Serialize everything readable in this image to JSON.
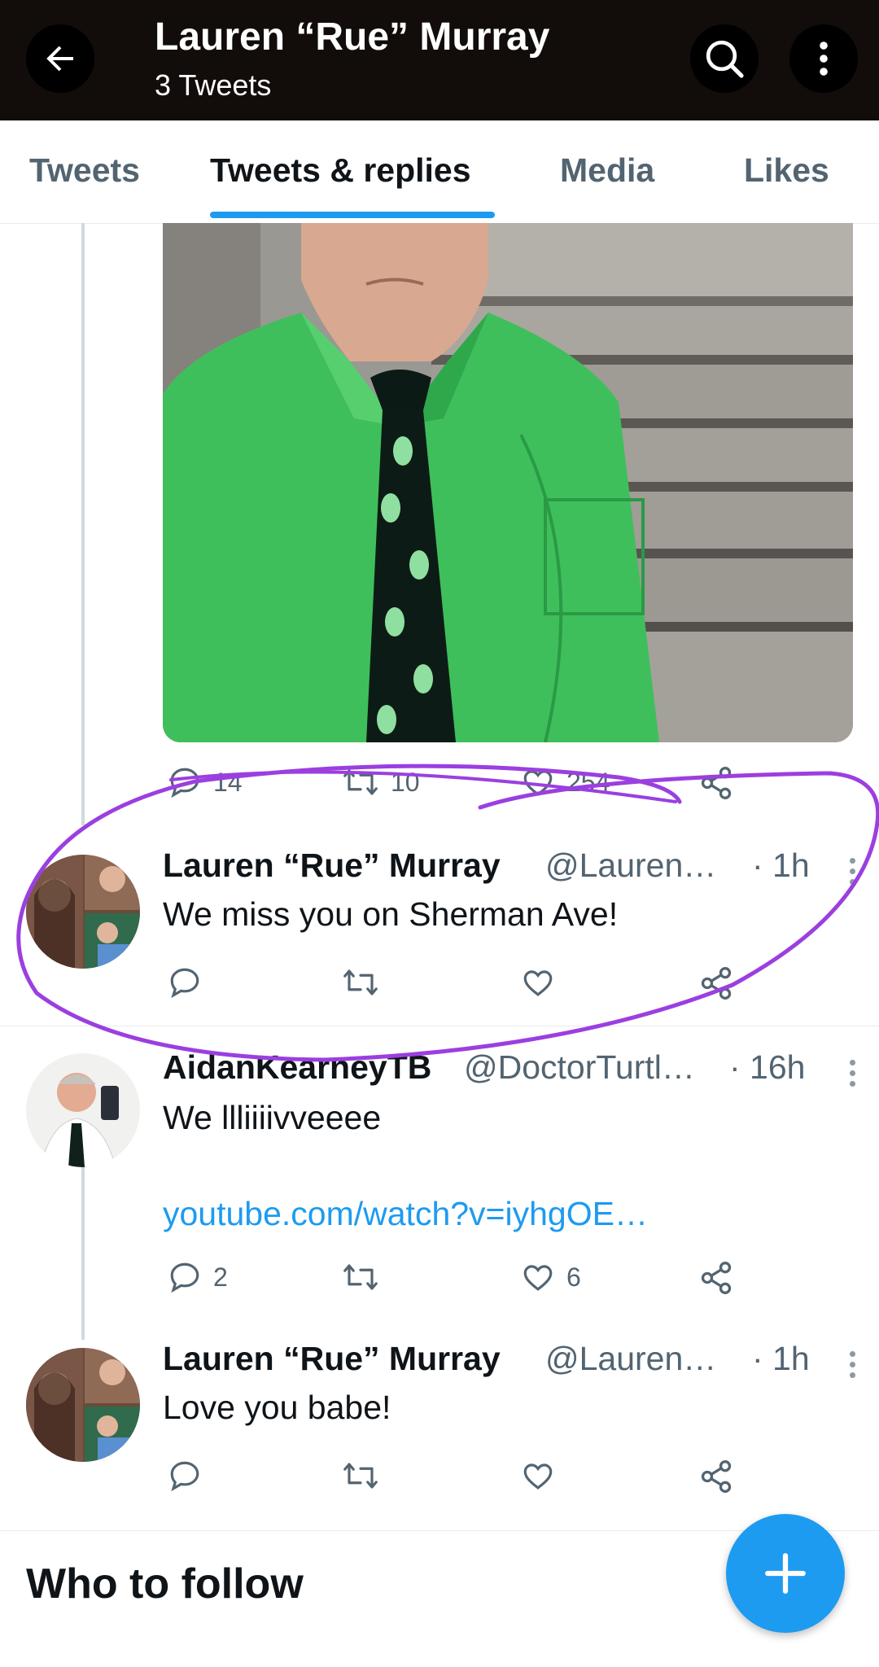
{
  "header": {
    "title": "Lauren “Rue” Murray",
    "subtitle": "3 Tweets",
    "back_icon": "arrow-left-icon",
    "search_icon": "search-icon",
    "more_icon": "more-vertical-icon"
  },
  "tabs": [
    {
      "label": "Tweets",
      "active": false
    },
    {
      "label": "Tweets & replies",
      "active": true
    },
    {
      "label": "Media",
      "active": false
    },
    {
      "label": "Likes",
      "active": false
    }
  ],
  "media_tweet": {
    "reply_count": "14",
    "retweet_count": "10",
    "like_count": "254"
  },
  "tweets": [
    {
      "name": "Lauren “Rue” Murray",
      "handle": "@Lauren…",
      "time": "· 1h",
      "text": "We miss you on Sherman Ave!",
      "reply_count": "",
      "retweet_count": "",
      "like_count": ""
    },
    {
      "name": "AidanKearneyTB",
      "handle": "@DoctorTurtl…",
      "time": "· 16h",
      "text": "We llliiiivveeee",
      "link": "youtube.com/watch?v=iyhgOE…",
      "reply_count": "2",
      "retweet_count": "",
      "like_count": "6"
    },
    {
      "name": "Lauren “Rue” Murray",
      "handle": "@Lauren…",
      "time": "· 1h",
      "text": "Love you babe!",
      "reply_count": "",
      "retweet_count": "",
      "like_count": ""
    }
  ],
  "who_to_follow": "Who to follow",
  "fab_icon": "plus-icon",
  "colors": {
    "accent": "#1d9bf0",
    "header_bg": "#120c0a",
    "annotation": "#9b3fe0",
    "secondary_text": "#536471"
  }
}
